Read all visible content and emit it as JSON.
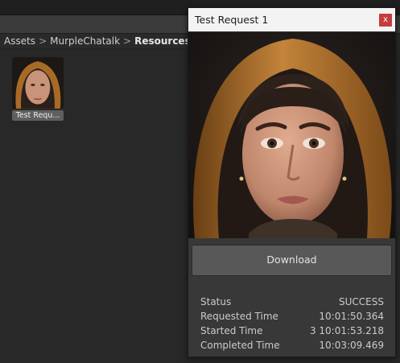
{
  "breadcrumb": {
    "items": [
      "Assets",
      "MurpleChatalk",
      "Resources"
    ],
    "separator": ">"
  },
  "assets": [
    {
      "label": "Test Requ..."
    }
  ],
  "popup": {
    "title": "Test Request 1",
    "close_label": "x",
    "download_label": "Download",
    "info": [
      {
        "label": "Status",
        "value": "SUCCESS"
      },
      {
        "label": "Requested Time",
        "value": "10:01:50.364"
      },
      {
        "label": "Started Time",
        "value": "3 10:01:53.218"
      },
      {
        "label": "Completed Time",
        "value": "10:03:09.469"
      }
    ]
  },
  "colors": {
    "close_button": "#c43d3d",
    "panel_bg": "#383838",
    "titlebar_bg": "#f3f3f3",
    "hood": "#b8782c"
  }
}
